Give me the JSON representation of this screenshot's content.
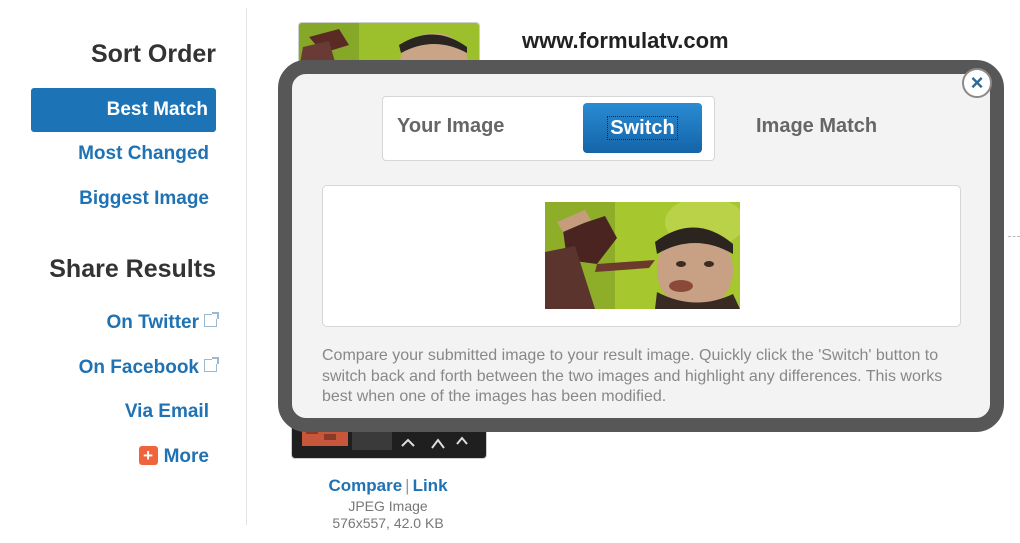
{
  "sidebar": {
    "sort_heading": "Sort Order",
    "sort_items": [
      {
        "label": "Best Match",
        "active": true
      },
      {
        "label": "Most Changed",
        "active": false
      },
      {
        "label": "Biggest Image",
        "active": false
      }
    ],
    "share_heading": "Share Results",
    "share_items": [
      {
        "label": "On Twitter",
        "icon": "external-link-icon"
      },
      {
        "label": "On Facebook",
        "icon": "external-link-icon"
      },
      {
        "label": "Via Email",
        "icon": null
      },
      {
        "label": "More",
        "icon": "plus-icon"
      }
    ]
  },
  "result": {
    "site": "www.formulatv.com",
    "compare_link": "Compare",
    "separator": "|",
    "link_label": "Link",
    "image_type": "JPEG Image",
    "image_size": "576x557, 42.0 KB"
  },
  "modal": {
    "close_label": "×",
    "your_image_label": "Your Image",
    "switch_label": "Switch",
    "image_match_label": "Image Match",
    "description": "Compare your submitted image to your result image. Quickly click the 'Switch' button to switch back and forth between the two images and highlight any differences. This works best when one of the images has been modified."
  },
  "colors": {
    "accent": "#1c74b6",
    "link": "#1f72b3",
    "modal_border": "#575757",
    "more_icon": "#f0643c"
  }
}
